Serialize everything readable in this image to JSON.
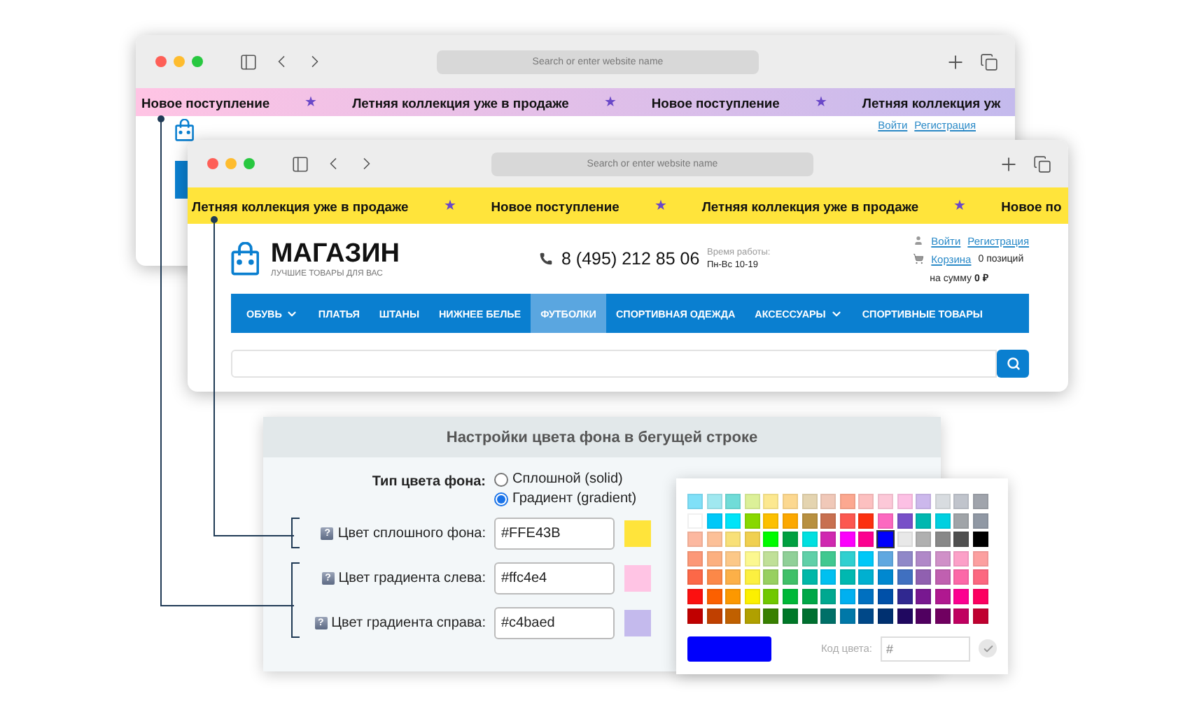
{
  "back_window": {
    "address_placeholder": "Search or enter website name",
    "ticker": {
      "kind": "gradient",
      "items": [
        {
          "kind": "text",
          "text": "Новое поступление"
        },
        {
          "kind": "star",
          "text": "★"
        },
        {
          "kind": "text",
          "text": "Летняя коллекция уже в продаже"
        },
        {
          "kind": "star",
          "text": "★"
        },
        {
          "kind": "text",
          "text": "Новое поступление"
        },
        {
          "kind": "star",
          "text": "★"
        },
        {
          "kind": "text",
          "text": "Летняя коллекция уж"
        }
      ]
    },
    "account": {
      "login": "Войти",
      "register": "Регистрация"
    }
  },
  "front_window": {
    "address_placeholder": "Search or enter website name",
    "ticker": {
      "kind": "solid",
      "items": [
        {
          "kind": "text",
          "text": "Летняя коллекция уже в продаже"
        },
        {
          "kind": "star",
          "text": "★"
        },
        {
          "kind": "text",
          "text": "Новое поступление"
        },
        {
          "kind": "star",
          "text": "★"
        },
        {
          "kind": "text",
          "text": "Летняя коллекция уже в продаже"
        },
        {
          "kind": "star",
          "text": "★"
        },
        {
          "kind": "text",
          "text": "Новое по"
        }
      ]
    },
    "store": {
      "title": "МАГАЗИН",
      "subtitle": "ЛУЧШИЕ ТОВАРЫ ДЛЯ ВАС",
      "phone": "8 (495) 212 85 06",
      "hours_label": "Время работы:",
      "hours": "Пн-Вс 10-19",
      "login": "Войти",
      "register": "Регистрация",
      "cart": "Корзина",
      "cart_count": "0 позиций",
      "cart_total": "на сумму **0 ₽**",
      "nav": [
        {
          "label": "ОБУВЬ",
          "dropdown": true,
          "selected": false
        },
        {
          "label": "ПЛАТЬЯ",
          "dropdown": false,
          "selected": false
        },
        {
          "label": "ШТАНЫ",
          "dropdown": false,
          "selected": false
        },
        {
          "label": "НИЖНЕЕ БЕЛЬЕ",
          "dropdown": false,
          "selected": false
        },
        {
          "label": "ФУТБОЛКИ",
          "dropdown": false,
          "selected": true
        },
        {
          "label": "СПОРТИВНАЯ ОДЕЖДА",
          "dropdown": false,
          "selected": false
        },
        {
          "label": "АКСЕССУАРЫ",
          "dropdown": true,
          "selected": false
        },
        {
          "label": "СПОРТИВНЫЕ ТОВАРЫ",
          "dropdown": false,
          "selected": false
        }
      ]
    }
  },
  "settings": {
    "title": "Настройки цвета фона в бегущей строке",
    "type_label": "Тип цвета фона:",
    "type_options": [
      {
        "label": "Сплошной (solid)",
        "selected": false
      },
      {
        "label": "Градиент (gradient)",
        "selected": true
      }
    ],
    "groups": [
      {
        "fields": [
          {
            "help": "?",
            "label": "Цвет сплошного фона:",
            "value": "#FFE43B"
          }
        ]
      },
      {
        "fields": [
          {
            "help": "?",
            "label": "Цвет градиента слева:",
            "value": "#ffc4e4"
          },
          {
            "help": "?",
            "label": "Цвет градиента справа:",
            "value": "#c4baed"
          }
        ]
      }
    ]
  },
  "color_picker": {
    "code_label": "Код цвета:",
    "code_prefix": "#",
    "rows": [
      [
        {
          "color": "#80e0f8",
          "selected": false
        },
        {
          "color": "#a0e8f0",
          "selected": false
        },
        {
          "color": "#70dcd8",
          "selected": false
        },
        {
          "color": "#dcf098",
          "selected": false
        },
        {
          "color": "#fce890",
          "selected": false
        },
        {
          "color": "#fcd890",
          "selected": false
        },
        {
          "color": "#e4d4b0",
          "selected": false
        },
        {
          "color": "#f0c8b8",
          "selected": false
        },
        {
          "color": "#fca890",
          "selected": false
        },
        {
          "color": "#fcc0c0",
          "selected": false
        },
        {
          "color": "#fcc8d8",
          "selected": false
        },
        {
          "color": "#fcc0e4",
          "selected": false
        },
        {
          "color": "#ccb8ec",
          "selected": false
        },
        {
          "color": "#d8dce0",
          "selected": false
        },
        {
          "color": "#c0c4cc",
          "selected": false
        },
        {
          "color": "#a0a4ac",
          "selected": false
        }
      ],
      [
        {
          "color": "#ffffff",
          "selected": false
        },
        {
          "color": "#00c8f8",
          "selected": false
        },
        {
          "color": "#00e4f8",
          "selected": false
        },
        {
          "color": "#88d800",
          "selected": false
        },
        {
          "color": "#fcc000",
          "selected": false
        },
        {
          "color": "#fca800",
          "selected": false
        },
        {
          "color": "#b89040",
          "selected": false
        },
        {
          "color": "#c87050",
          "selected": false
        },
        {
          "color": "#fc5850",
          "selected": false
        },
        {
          "color": "#fc3010",
          "selected": false
        },
        {
          "color": "#fc68c0",
          "selected": false
        },
        {
          "color": "#7850c8",
          "selected": false
        },
        {
          "color": "#00b8b0",
          "selected": false
        },
        {
          "color": "#00d0e0",
          "selected": false
        },
        {
          "color": "#a0a4a8",
          "selected": false
        },
        {
          "color": "#9098a4",
          "selected": false
        }
      ],
      [
        {
          "color": "#fcb8a0",
          "selected": false
        },
        {
          "color": "#fcc098",
          "selected": false
        },
        {
          "color": "#f8e078",
          "selected": false
        },
        {
          "color": "#f0d050",
          "selected": false
        },
        {
          "color": "#00fc00",
          "selected": false
        },
        {
          "color": "#00a040",
          "selected": false
        },
        {
          "color": "#00e0e0",
          "selected": false
        },
        {
          "color": "#d028b0",
          "selected": false
        },
        {
          "color": "#fc00fc",
          "selected": false
        },
        {
          "color": "#fc0090",
          "selected": false
        },
        {
          "color": "#0000fc",
          "selected": true
        },
        {
          "color": "#e8e8e8",
          "selected": false
        },
        {
          "color": "#b0b0b0",
          "selected": false
        },
        {
          "color": "#888888",
          "selected": false
        },
        {
          "color": "#505050",
          "selected": false
        },
        {
          "color": "#000000",
          "selected": false
        }
      ],
      [
        {
          "color": "#fc9878",
          "selected": false
        },
        {
          "color": "#fcb080",
          "selected": false
        },
        {
          "color": "#fcc888",
          "selected": false
        },
        {
          "color": "#fcf890",
          "selected": false
        },
        {
          "color": "#c0e098",
          "selected": false
        },
        {
          "color": "#90d098",
          "selected": false
        },
        {
          "color": "#60d0a8",
          "selected": false
        },
        {
          "color": "#40c890",
          "selected": false
        },
        {
          "color": "#30d0d0",
          "selected": false
        },
        {
          "color": "#00c8f8",
          "selected": false
        },
        {
          "color": "#60a8e0",
          "selected": false
        },
        {
          "color": "#9088c8",
          "selected": false
        },
        {
          "color": "#b088c8",
          "selected": false
        },
        {
          "color": "#d090c8",
          "selected": false
        },
        {
          "color": "#fca0c8",
          "selected": false
        },
        {
          "color": "#fca0a0",
          "selected": false
        }
      ],
      [
        {
          "color": "#fc6848",
          "selected": false
        },
        {
          "color": "#fc8848",
          "selected": false
        },
        {
          "color": "#fcb048",
          "selected": false
        },
        {
          "color": "#fcf040",
          "selected": false
        },
        {
          "color": "#98d060",
          "selected": false
        },
        {
          "color": "#40c068",
          "selected": false
        },
        {
          "color": "#00b8a8",
          "selected": false
        },
        {
          "color": "#00c0f0",
          "selected": false
        },
        {
          "color": "#00b8b0",
          "selected": false
        },
        {
          "color": "#00b0d0",
          "selected": false
        },
        {
          "color": "#0088d0",
          "selected": false
        },
        {
          "color": "#4070c0",
          "selected": false
        },
        {
          "color": "#9060b0",
          "selected": false
        },
        {
          "color": "#c060b0",
          "selected": false
        },
        {
          "color": "#fc68a8",
          "selected": false
        },
        {
          "color": "#fc6880",
          "selected": false
        }
      ],
      [
        {
          "color": "#fc1010",
          "selected": false
        },
        {
          "color": "#fc6000",
          "selected": false
        },
        {
          "color": "#fc9800",
          "selected": false
        },
        {
          "color": "#fcf000",
          "selected": false
        },
        {
          "color": "#70c800",
          "selected": false
        },
        {
          "color": "#00b838",
          "selected": false
        },
        {
          "color": "#00a848",
          "selected": false
        },
        {
          "color": "#00a890",
          "selected": false
        },
        {
          "color": "#00b0f0",
          "selected": false
        },
        {
          "color": "#0070c0",
          "selected": false
        },
        {
          "color": "#0050a8",
          "selected": false
        },
        {
          "color": "#302890",
          "selected": false
        },
        {
          "color": "#781890",
          "selected": false
        },
        {
          "color": "#b01890",
          "selected": false
        },
        {
          "color": "#fc0090",
          "selected": false
        },
        {
          "color": "#fc0060",
          "selected": false
        }
      ],
      [
        {
          "color": "#c00000",
          "selected": false
        },
        {
          "color": "#c04000",
          "selected": false
        },
        {
          "color": "#c06000",
          "selected": false
        },
        {
          "color": "#b0a000",
          "selected": false
        },
        {
          "color": "#388000",
          "selected": false
        },
        {
          "color": "#007828",
          "selected": false
        },
        {
          "color": "#007030",
          "selected": false
        },
        {
          "color": "#007068",
          "selected": false
        },
        {
          "color": "#0078a8",
          "selected": false
        },
        {
          "color": "#004888",
          "selected": false
        },
        {
          "color": "#003070",
          "selected": false
        },
        {
          "color": "#200860",
          "selected": false
        },
        {
          "color": "#500060",
          "selected": false
        },
        {
          "color": "#700060",
          "selected": false
        },
        {
          "color": "#c00060",
          "selected": false
        },
        {
          "color": "#c00030",
          "selected": false
        }
      ]
    ]
  }
}
